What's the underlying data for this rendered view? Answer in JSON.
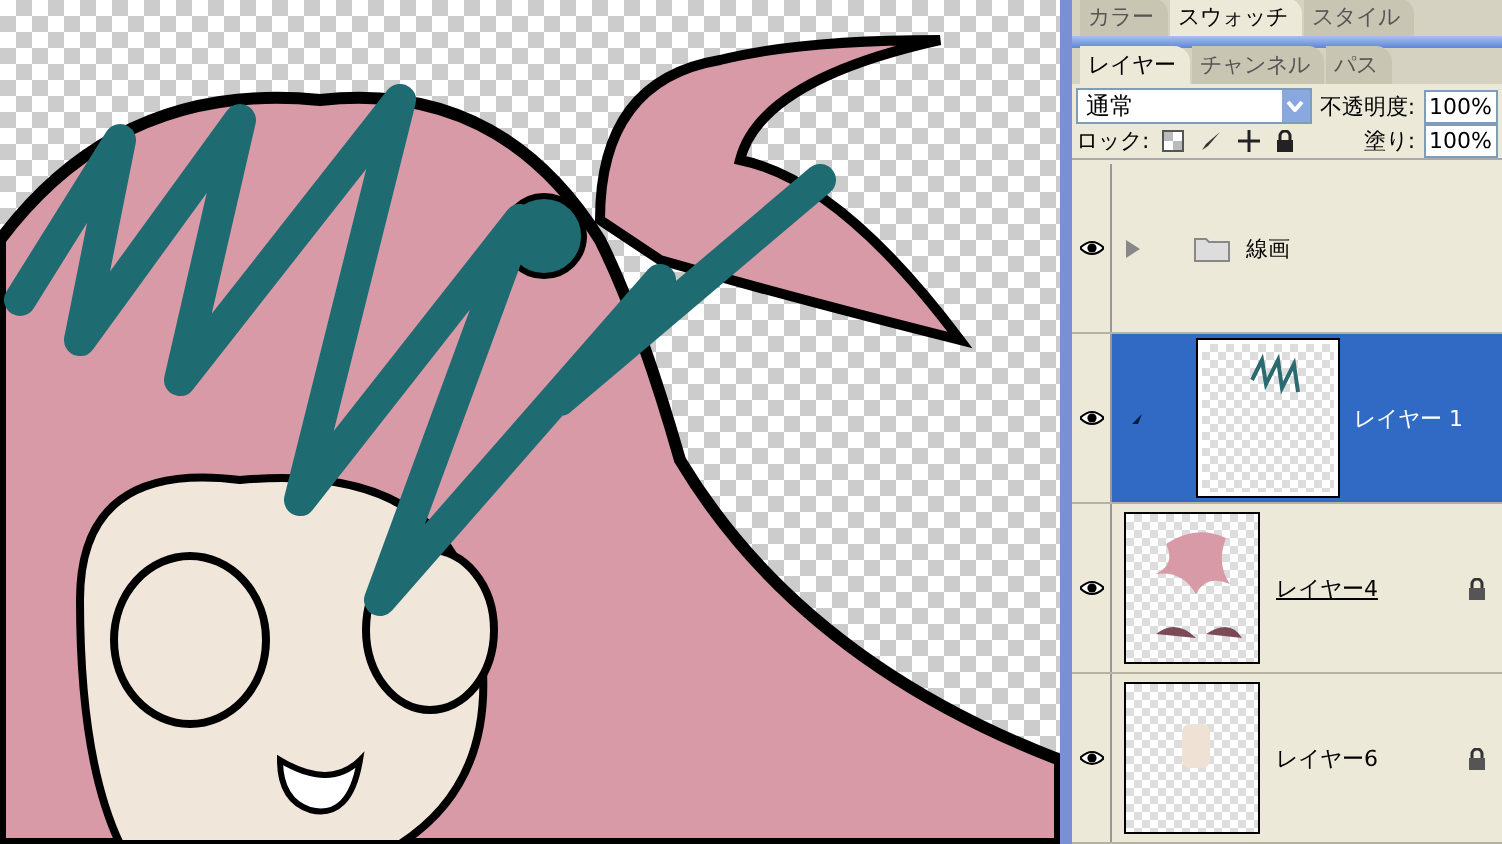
{
  "palette_tabs": [
    {
      "label": "カラー",
      "selected": false
    },
    {
      "label": "スウォッチ",
      "selected": true
    },
    {
      "label": "スタイル",
      "selected": false
    }
  ],
  "layer_tabs": [
    {
      "label": "レイヤー",
      "selected": true
    },
    {
      "label": "チャンネル",
      "selected": false
    },
    {
      "label": "パス",
      "selected": false
    }
  ],
  "blend_mode": {
    "value": "通常"
  },
  "opacity": {
    "label": "不透明度:",
    "value": "100%"
  },
  "lock": {
    "label": "ロック:"
  },
  "fill": {
    "label": "塗り:",
    "value": "100%"
  },
  "layers": [
    {
      "kind": "group",
      "name": "線画",
      "visible": true,
      "selected": false,
      "locked": false,
      "underlined": false,
      "expanded": false
    },
    {
      "kind": "scribble",
      "name": "レイヤー 1",
      "visible": true,
      "selected": true,
      "locked": false,
      "underlined": false
    },
    {
      "kind": "hair",
      "name": "レイヤー4",
      "visible": true,
      "selected": false,
      "locked": true,
      "underlined": true
    },
    {
      "kind": "skin",
      "name": "レイヤー6",
      "visible": true,
      "selected": false,
      "locked": true,
      "underlined": false
    }
  ]
}
